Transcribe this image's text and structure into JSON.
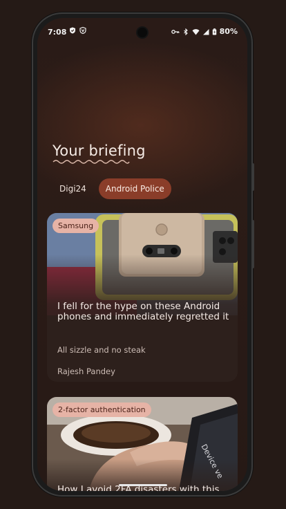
{
  "status_bar": {
    "time": "7:08",
    "battery": "80%",
    "left_icons": [
      "shield-icon",
      "vpn-icon"
    ],
    "right_icons": [
      "key-icon",
      "bluetooth-icon",
      "wifi-icon",
      "signal-icon",
      "battery-charging-icon"
    ]
  },
  "briefing": {
    "title": "Your briefing",
    "tabs": [
      {
        "label": "Digi24",
        "selected": false
      },
      {
        "label": "Android Police",
        "selected": true
      }
    ]
  },
  "cards": [
    {
      "chip": "Samsung",
      "headline": "I fell for the hype on these Android phones and immediately regretted it",
      "subtitle": "All sizzle and no steak",
      "author": "Rajesh Pandey"
    },
    {
      "chip": "2-factor authentication",
      "headline": "How I avoid 2FA disasters with this",
      "image_text": "Device ve"
    }
  ],
  "colors": {
    "background": "#251a16",
    "accent": "#8a3d29",
    "chip": "#e6b3a6"
  }
}
